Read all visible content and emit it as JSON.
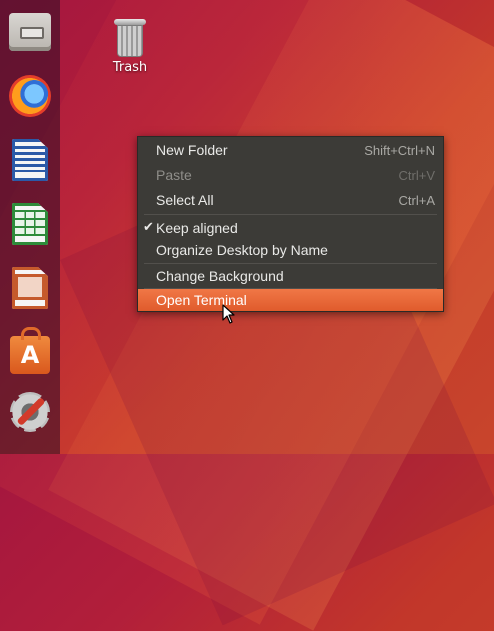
{
  "dock": {
    "items": [
      {
        "id": "files",
        "icon": "files-icon"
      },
      {
        "id": "firefox",
        "icon": "firefox-icon"
      },
      {
        "id": "writer",
        "icon": "libreoffice-writer-icon"
      },
      {
        "id": "calc",
        "icon": "libreoffice-calc-icon"
      },
      {
        "id": "impress",
        "icon": "libreoffice-impress-icon"
      },
      {
        "id": "software",
        "icon": "ubuntu-software-icon",
        "glyph": "A"
      },
      {
        "id": "settings",
        "icon": "settings-icon"
      }
    ]
  },
  "desktop": {
    "trash_label": "Trash"
  },
  "context_menu": {
    "new_folder": {
      "label": "New Folder",
      "accel": "Shift+Ctrl+N"
    },
    "paste": {
      "label": "Paste",
      "accel": "Ctrl+V",
      "disabled": true
    },
    "select_all": {
      "label": "Select All",
      "accel": "Ctrl+A"
    },
    "keep_aligned": {
      "label": "Keep aligned",
      "checked": true
    },
    "organize": {
      "label": "Organize Desktop by Name"
    },
    "change_background": {
      "label": "Change Background"
    },
    "open_terminal": {
      "label": "Open Terminal",
      "highlighted": true
    }
  },
  "colors": {
    "menu_bg": "#3c3b37",
    "highlight": "#e95420",
    "dock_bg": "#3c1028"
  }
}
